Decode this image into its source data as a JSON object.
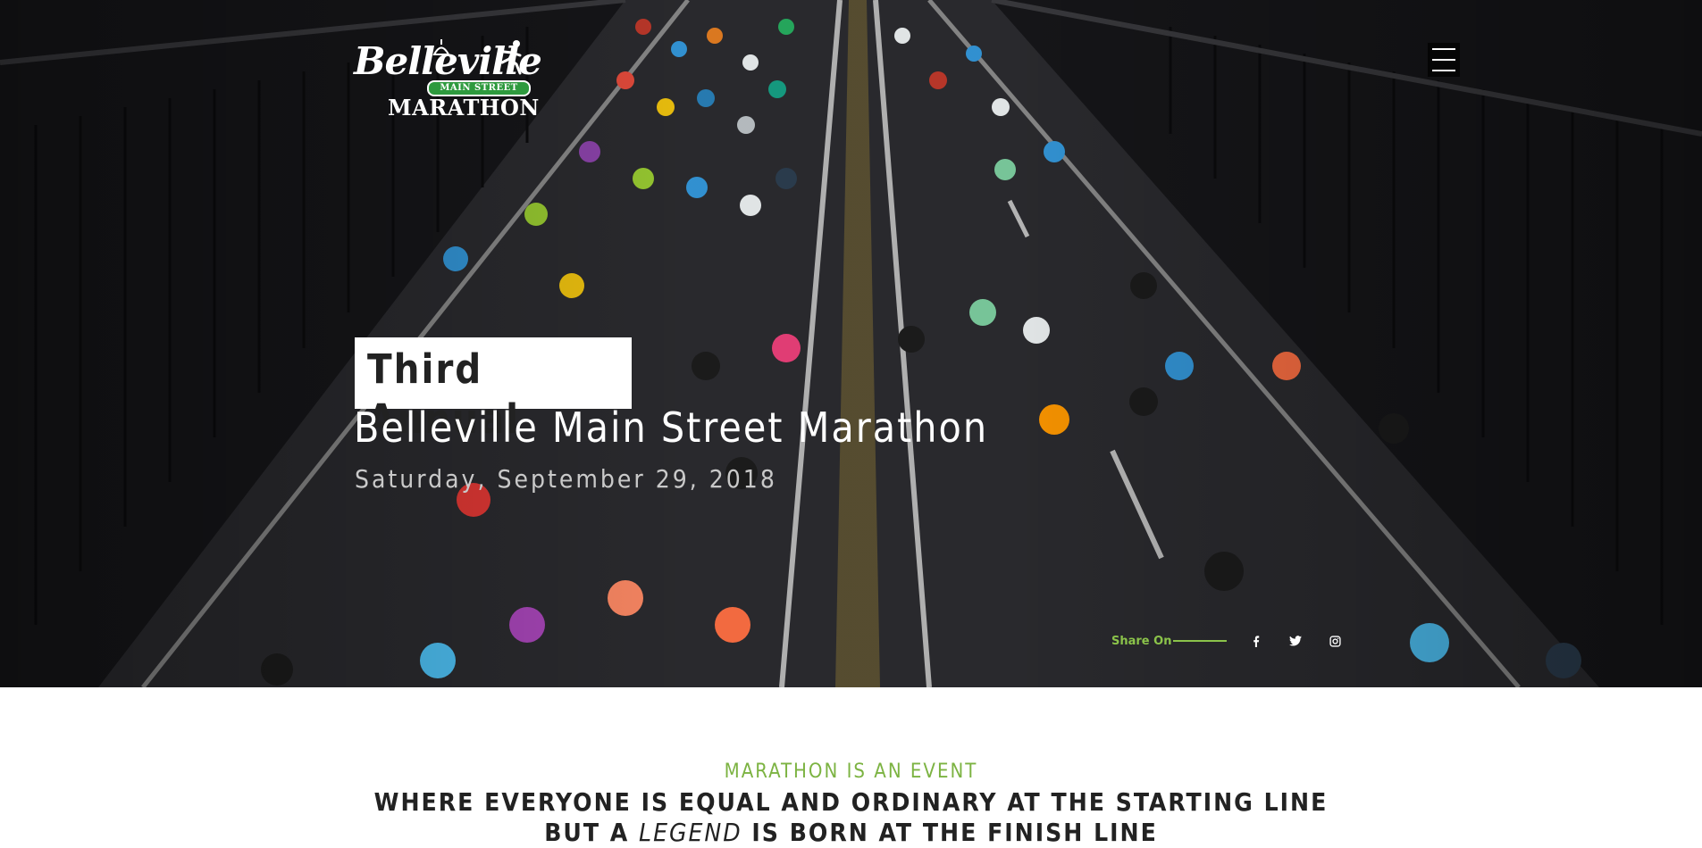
{
  "header": {
    "logo": {
      "script_text": "Belleville",
      "ribbon_text": "MAIN STREET",
      "wordmark": "MARATHON"
    },
    "menu_icon": "hamburger-menu-icon"
  },
  "hero": {
    "tag": "Third Annual",
    "title": "Belleville Main Street Marathon",
    "date": "Saturday, September 29, 2018",
    "share": {
      "label": "Share On",
      "icons": [
        "facebook-icon",
        "twitter-icon",
        "instagram-icon"
      ]
    }
  },
  "intro": {
    "kicker": "MARATHON IS AN EVENT",
    "line1": "WHERE EVERYONE IS EQUAL AND ORDINARY AT THE STARTING LINE",
    "line2_prefix": "BUT A ",
    "line2_emphasis": "LEGEND",
    "line2_suffix": " IS BORN AT THE FINISH LINE"
  },
  "colors": {
    "accent_green": "#7cb342",
    "share_green": "#8bc34a",
    "logo_ribbon": "#2e9a3e",
    "text_dark": "#222222"
  }
}
